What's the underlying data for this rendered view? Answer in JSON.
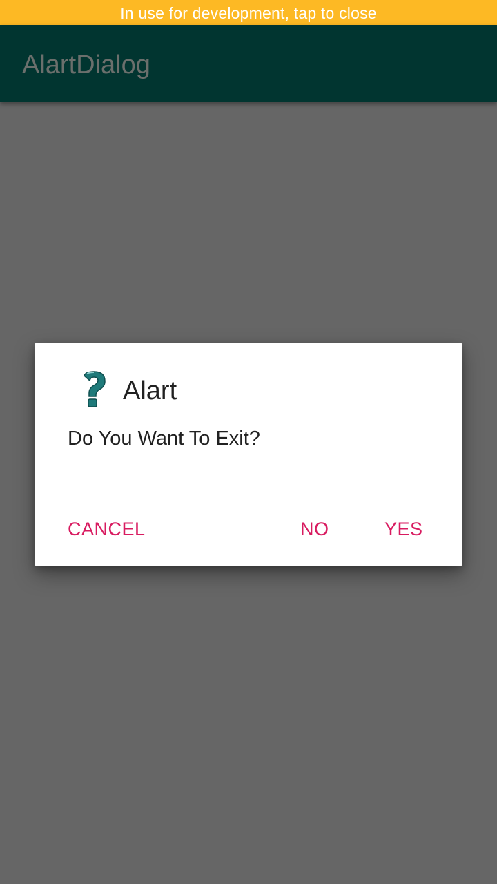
{
  "status_banner": {
    "text": "In use for development, tap to close",
    "color": "#FDB924"
  },
  "app_bar": {
    "title": "AlartDialog",
    "color": "#013530"
  },
  "dialog": {
    "icon": "question-mark-icon",
    "title": "Alart",
    "message": "Do You Want To Exit?",
    "buttons": {
      "cancel": "CANCEL",
      "no": "NO",
      "yes": "YES"
    },
    "accent_color": "#D81B60",
    "icon_color": "#1F7A7A"
  },
  "scrim_color": "#666666"
}
